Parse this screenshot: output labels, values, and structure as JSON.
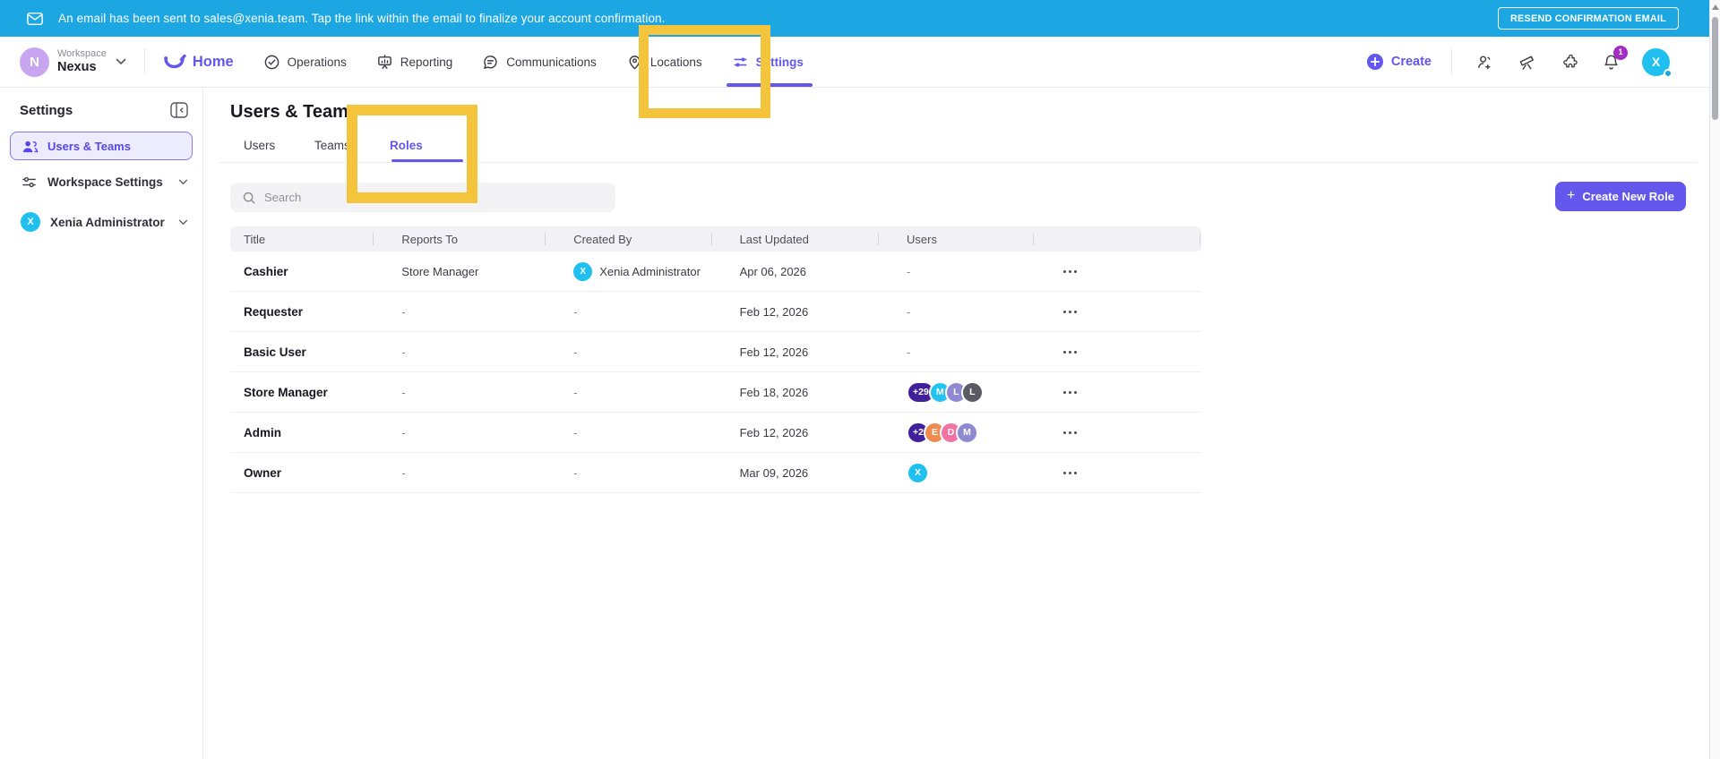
{
  "banner": {
    "message": "An email has been sent to sales@xenia.team. Tap the link within the email to finalize your account confirmation.",
    "resend_label": "RESEND CONFIRMATION EMAIL",
    "bg_color": "#1CA7E2"
  },
  "topnav": {
    "workspace_label": "Workspace",
    "workspace_name": "Nexus",
    "workspace_avatar": "N",
    "items": [
      {
        "label": "Home"
      },
      {
        "label": "Operations"
      },
      {
        "label": "Reporting"
      },
      {
        "label": "Communications"
      },
      {
        "label": "Locations"
      },
      {
        "label": "Settings"
      }
    ],
    "create_label": "Create",
    "notification_badge": "1",
    "user_avatar": "X"
  },
  "sidebar": {
    "heading": "Settings",
    "items": [
      {
        "label": "Users & Teams"
      },
      {
        "label": "Workspace Settings"
      },
      {
        "label": "Xenia Administrator",
        "avatar": "X"
      }
    ]
  },
  "main": {
    "title": "Users & Teams",
    "tabs": [
      {
        "label": "Users"
      },
      {
        "label": "Teams"
      },
      {
        "label": "Roles"
      }
    ],
    "active_tab": "Roles",
    "search_placeholder": "Search",
    "create_role_label": "Create New Role",
    "table": {
      "columns": [
        "Title",
        "Reports To",
        "Created By",
        "Last Updated",
        "Users",
        ""
      ],
      "empty_value": "-",
      "rows": [
        {
          "title": "Cashier",
          "reports_to": "Store Manager",
          "created_by": "Xenia Administrator",
          "created_by_avatar": {
            "letter": "X",
            "color": "#1FC0EF"
          },
          "last_updated": "Apr 06, 2026",
          "users": []
        },
        {
          "title": "Requester",
          "reports_to": "-",
          "created_by": "-",
          "last_updated": "Feb 12, 2026",
          "users": []
        },
        {
          "title": "Basic User",
          "reports_to": "-",
          "created_by": "-",
          "last_updated": "Feb 12, 2026",
          "users": []
        },
        {
          "title": "Store Manager",
          "reports_to": "-",
          "created_by": "-",
          "last_updated": "Feb 18, 2026",
          "users": [
            {
              "label": "+29",
              "color": "#41209B"
            },
            {
              "label": "M",
              "color": "#24C4F2"
            },
            {
              "label": "L",
              "color": "#8F88D3"
            },
            {
              "label": "L",
              "color": "#5A5964"
            }
          ]
        },
        {
          "title": "Admin",
          "reports_to": "-",
          "created_by": "-",
          "last_updated": "Feb 12, 2026",
          "users": [
            {
              "label": "+2",
              "color": "#41209B"
            },
            {
              "label": "E",
              "color": "#EF8A51"
            },
            {
              "label": "D",
              "color": "#F172A3"
            },
            {
              "label": "M",
              "color": "#8F88D3"
            }
          ]
        },
        {
          "title": "Owner",
          "reports_to": "-",
          "created_by": "-",
          "last_updated": "Mar 09, 2026",
          "users": [
            {
              "label": "X",
              "color": "#1FC0EF"
            }
          ]
        }
      ]
    }
  },
  "colors": {
    "brand": "#6357EE",
    "banner_bg": "#1CA7E2",
    "annotation": "#F4C43D"
  }
}
